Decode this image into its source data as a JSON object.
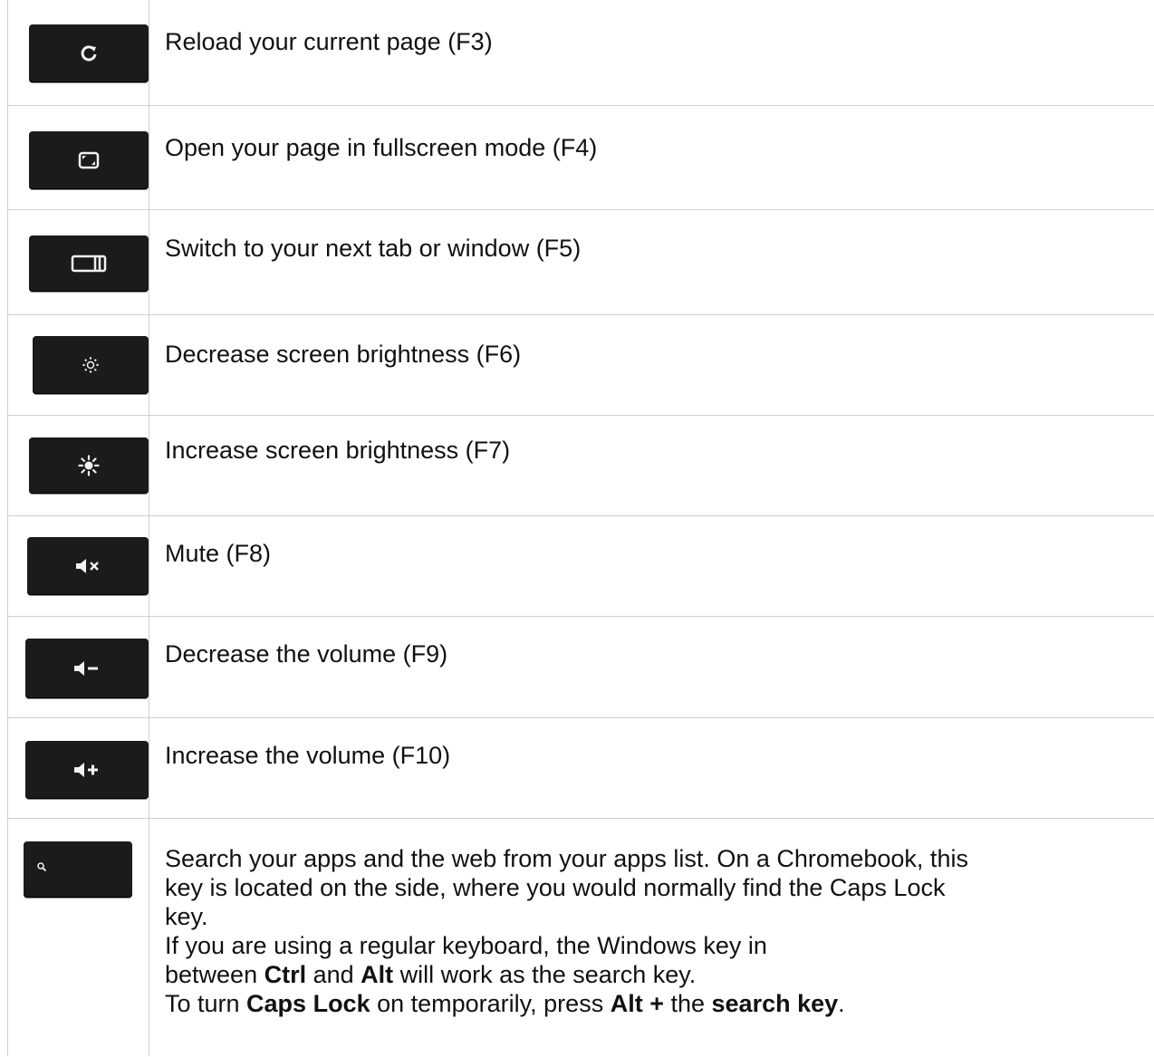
{
  "rows": [
    {
      "key_icon": "reload-icon",
      "text": "Reload your current page (F3)"
    },
    {
      "key_icon": "fullscreen-icon",
      "text": "Open your page in fullscreen mode (F4)"
    },
    {
      "key_icon": "window-switch-icon",
      "text": "Switch to your next tab or window (F5)"
    },
    {
      "key_icon": "brightness-down-icon",
      "text": "Decrease screen brightness (F6)"
    },
    {
      "key_icon": "brightness-up-icon",
      "text": "Increase screen brightness (F7)"
    },
    {
      "key_icon": "mute-icon",
      "text": "Mute (F8)"
    },
    {
      "key_icon": "volume-down-icon",
      "text": "Decrease the volume (F9)"
    },
    {
      "key_icon": "volume-up-icon",
      "text": "Increase the volume (F10)"
    }
  ],
  "search_row": {
    "key_icon": "search-icon",
    "line1": "Search your apps and the web from your apps list. On a Chromebook, this",
    "line2": "key is located on the side, where you would normally find the Caps Lock",
    "line3": "key.",
    "line4": "If you are using a regular keyboard, the Windows key in",
    "line5_a": "between ",
    "line5_b": "Ctrl",
    "line5_c": " and ",
    "line5_d": "Alt",
    "line5_e": " will work as the search key.",
    "line6_a": "To turn ",
    "line6_b": "Caps Lock",
    "line6_c": " on temporarily, press ",
    "line6_d": "Alt +",
    "line6_e": " the ",
    "line6_f": "search key",
    "line6_g": "."
  }
}
